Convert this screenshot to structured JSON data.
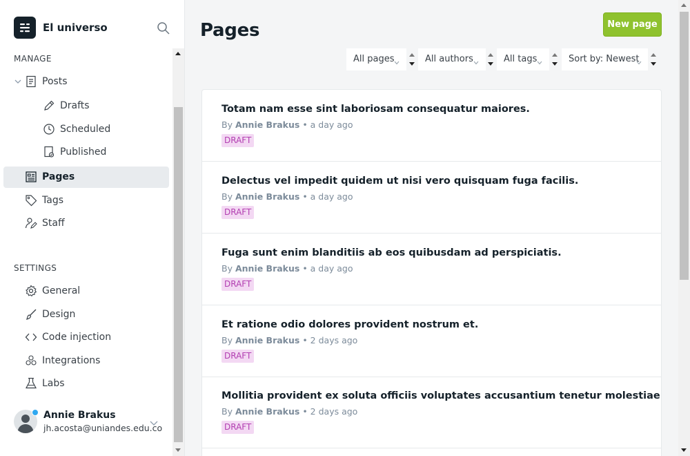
{
  "brand": {
    "name": "El universo"
  },
  "sidebar": {
    "manage_title": "MANAGE",
    "settings_title": "SETTINGS",
    "manage_items": [
      {
        "label": "Posts",
        "icon": "posts-icon"
      },
      {
        "label": "Drafts",
        "icon": "pencil-icon"
      },
      {
        "label": "Scheduled",
        "icon": "clock-icon"
      },
      {
        "label": "Published",
        "icon": "published-icon"
      },
      {
        "label": "Pages",
        "icon": "pages-icon",
        "active": true
      },
      {
        "label": "Tags",
        "icon": "tag-icon"
      },
      {
        "label": "Staff",
        "icon": "staff-icon"
      }
    ],
    "settings_items": [
      {
        "label": "General",
        "icon": "gear-icon"
      },
      {
        "label": "Design",
        "icon": "brush-icon"
      },
      {
        "label": "Code injection",
        "icon": "code-icon"
      },
      {
        "label": "Integrations",
        "icon": "integrations-icon"
      },
      {
        "label": "Labs",
        "icon": "flask-icon"
      }
    ],
    "user": {
      "name": "Annie Brakus",
      "email": "jh.acosta@uniandes.edu.co"
    }
  },
  "main": {
    "title": "Pages",
    "new_button": "New page",
    "filters": [
      "All pages",
      "All authors",
      "All tags",
      "Sort by: Newest"
    ],
    "rows": [
      {
        "title": "Totam nam esse sint laboriosam consequatur maiores.",
        "by": "By",
        "author": "Annie Brakus",
        "time": "a day ago",
        "status": "DRAFT"
      },
      {
        "title": "Delectus vel impedit quidem ut nisi vero quisquam fuga facilis.",
        "by": "By",
        "author": "Annie Brakus",
        "time": "a day ago",
        "status": "DRAFT"
      },
      {
        "title": "Fuga sunt enim blanditiis ab eos quibusdam ad perspiciatis.",
        "by": "By",
        "author": "Annie Brakus",
        "time": "a day ago",
        "status": "DRAFT"
      },
      {
        "title": "Et ratione odio dolores provident nostrum et.",
        "by": "By",
        "author": "Annie Brakus",
        "time": "2 days ago",
        "status": "DRAFT"
      },
      {
        "title": "Mollitia provident ex soluta officiis voluptates accusantium tenetur molestiae dolor.",
        "by": "By",
        "author": "Annie Brakus",
        "time": "2 days ago",
        "status": "DRAFT"
      }
    ]
  },
  "colors": {
    "accent": "#8fc22e",
    "draft_badge_bg": "#f3d8f3",
    "draft_badge_text": "#b23eb1",
    "active_nav_bg": "#e8ebee"
  }
}
